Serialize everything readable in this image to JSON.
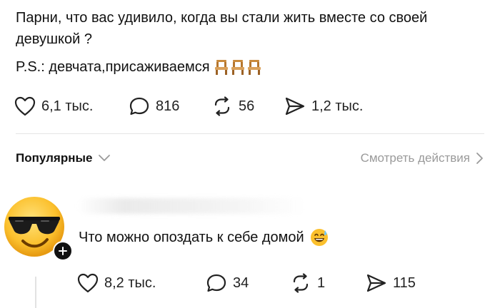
{
  "post": {
    "text": "Парни, что вас удивило, когда вы стали жить вместе со своей девушкой ?",
    "ps_text": "P.S.: девчата,присаживаемся",
    "ps_emoji": "chair-emoji",
    "stats": {
      "likes": "6,1 тыс.",
      "comments": "816",
      "reposts": "56",
      "shares": "1,2 тыс."
    }
  },
  "replies_header": {
    "sort_label": "Популярные",
    "activity_link": "Смотреть действия"
  },
  "comment": {
    "avatar": "sunglasses-emoji",
    "text": "Что можно опоздать к себе домой",
    "emoji": "grinning-sweat-emoji",
    "stats": {
      "likes": "8,2 тыс.",
      "comments": "34",
      "reposts": "1",
      "shares": "115"
    }
  },
  "colors": {
    "text": "#111111",
    "muted": "#9a9a9a",
    "icon": "#222222",
    "divider": "#e6e6e6"
  }
}
